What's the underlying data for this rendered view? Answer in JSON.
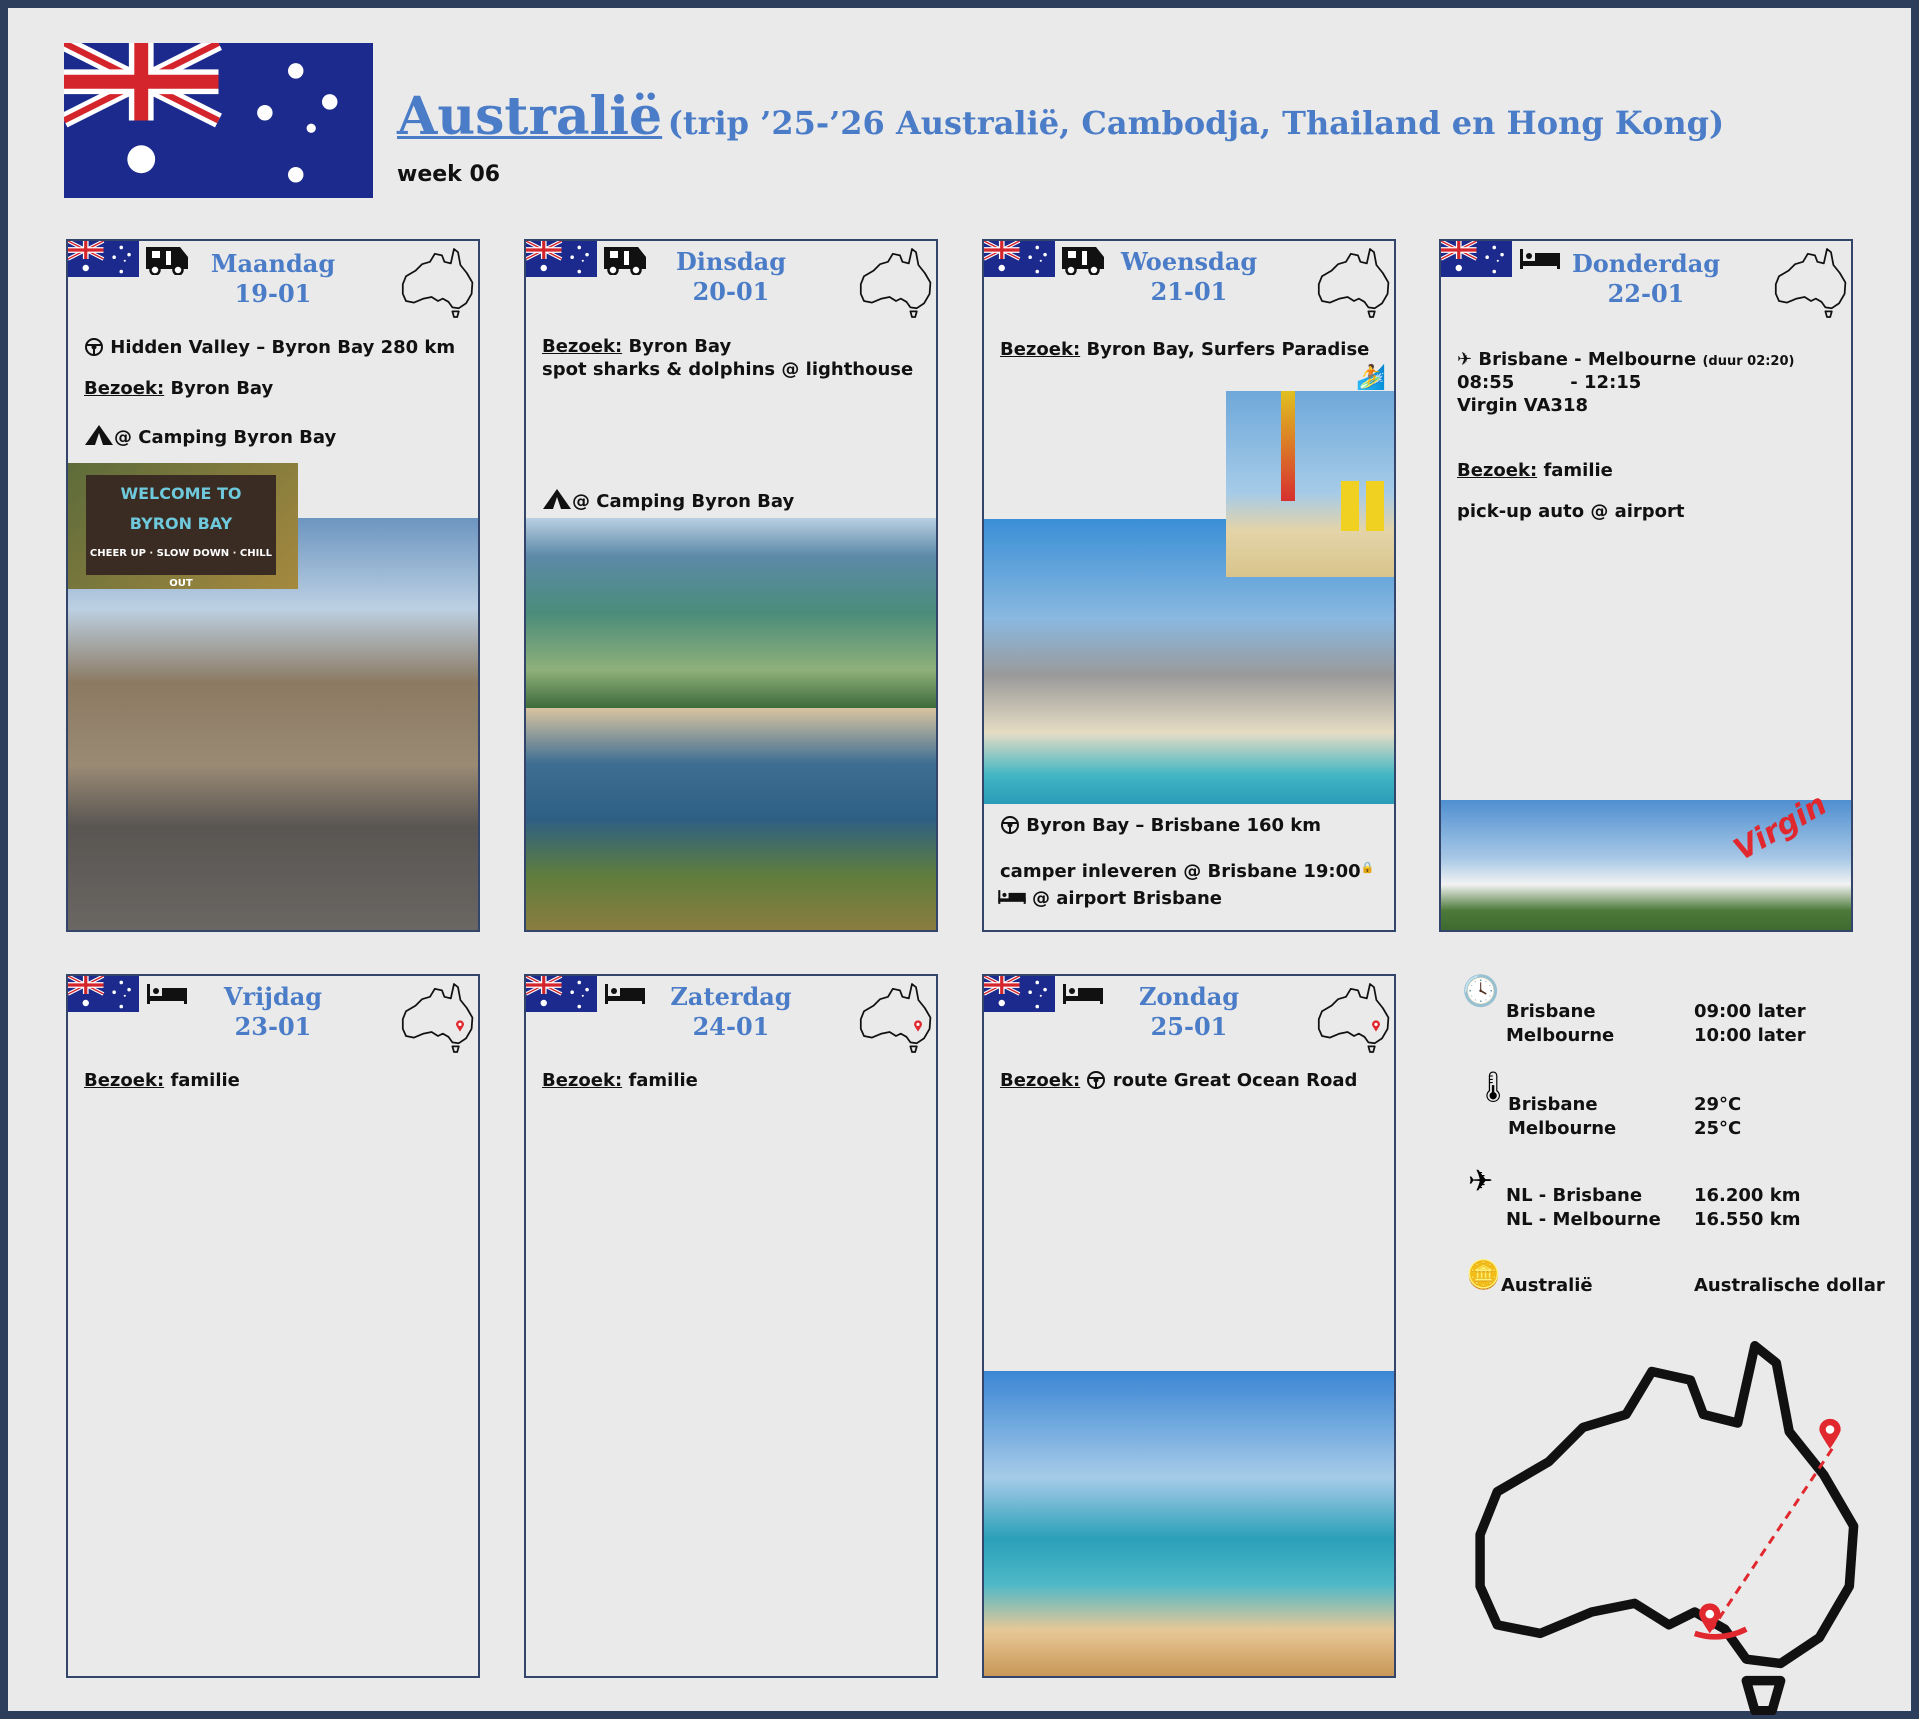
{
  "header": {
    "title": "Australië",
    "subtitle": "(trip ’25-’26 Australië, Cambodja, Thailand en Hong Kong)",
    "week": "week 06"
  },
  "bezoek_label": "Bezoek:",
  "days": [
    {
      "day": "Maandag",
      "date": "19-01",
      "transport": "camper-icon",
      "lines": {
        "drive": "Hidden Valley – Byron Bay 280 km",
        "visit": "Byron Bay",
        "stay": "@ Camping Byron Bay"
      },
      "sign": {
        "l1": "WELCOME TO",
        "l2": "BYRON BAY",
        "l3": "CHEER UP · SLOW DOWN · CHILL OUT"
      }
    },
    {
      "day": "Dinsdag",
      "date": "20-01",
      "transport": "camper-icon",
      "lines": {
        "visit": "Byron Bay",
        "extra": "spot sharks & dolphins @ lighthouse",
        "stay": "@ Camping Byron Bay"
      }
    },
    {
      "day": "Woensdag",
      "date": "21-01",
      "transport": "camper-icon",
      "lines": {
        "visit": "Byron Bay, Surfers Paradise",
        "drive": "Byron Bay – Brisbane 160 km",
        "return": "camper inleveren @ Brisbane 19:00",
        "stay": "@ airport Brisbane"
      }
    },
    {
      "day": "Donderdag",
      "date": "22-01",
      "transport": "bed-icon",
      "lines": {
        "flight": "Brisbane - Melbourne",
        "duration": "(duur 02:20)",
        "dep": "08:55",
        "arr": "- 12:15",
        "flightno": "Virgin VA318",
        "visit": "familie",
        "extra": "pick-up auto @ airport"
      },
      "plane_text": "Virgin"
    },
    {
      "day": "Vrijdag",
      "date": "23-01",
      "transport": "bed-icon",
      "lines": {
        "visit": "familie"
      }
    },
    {
      "day": "Zaterdag",
      "date": "24-01",
      "transport": "bed-icon",
      "lines": {
        "visit": "familie"
      }
    },
    {
      "day": "Zondag",
      "date": "25-01",
      "transport": "bed-icon",
      "lines": {
        "visit": "route Great Ocean Road"
      }
    }
  ],
  "info": {
    "timezone": [
      {
        "city": "Brisbane",
        "value": "09:00 later"
      },
      {
        "city": "Melbourne",
        "value": "10:00 later"
      }
    ],
    "temperature": [
      {
        "city": "Brisbane",
        "value": "29°C"
      },
      {
        "city": "Melbourne",
        "value": "25°C"
      }
    ],
    "distance": [
      {
        "city": "NL - Brisbane",
        "value": "16.200 km"
      },
      {
        "city": "NL - Melbourne",
        "value": "16.550 km"
      }
    ],
    "currency": {
      "country": "Australië",
      "value": "Australische dollar"
    }
  },
  "colors": {
    "accent": "#4a7cc7",
    "border": "#2c3e5c",
    "route": "#e0282e"
  }
}
